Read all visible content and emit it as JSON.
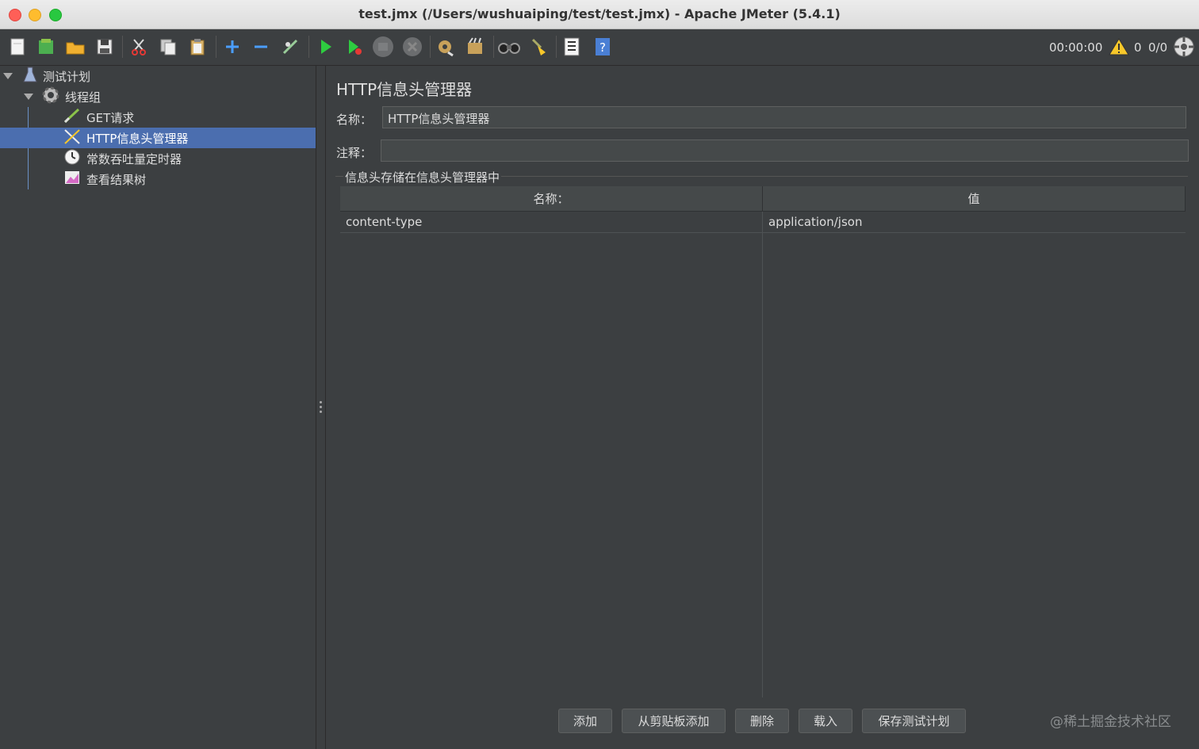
{
  "window": {
    "title": "test.jmx (/Users/wushuaiping/test/test.jmx) - Apache JMeter (5.4.1)"
  },
  "toolbar": {
    "icons": [
      "new-icon",
      "templates-icon",
      "open-icon",
      "save-icon",
      "cut-icon",
      "copy-icon",
      "paste-icon",
      "expand-icon",
      "collapse-icon",
      "toggle-icon",
      "start-icon",
      "start-no-pauses-icon",
      "stop-icon",
      "shutdown-icon",
      "clear-icon",
      "clear-all-icon",
      "search-icon",
      "reset-search-icon",
      "function-helper-icon",
      "help-icon"
    ],
    "timer": "00:00:00",
    "warning_count": "0",
    "threads": "0/0"
  },
  "tree": {
    "items": [
      {
        "label": "测试计划",
        "icon": "test-plan-icon"
      },
      {
        "label": "线程组",
        "icon": "thread-group-icon"
      },
      {
        "label": "GET请求",
        "icon": "sampler-icon"
      },
      {
        "label": "HTTP信息头管理器",
        "icon": "header-manager-icon",
        "selected": true
      },
      {
        "label": "常数吞吐量定时器",
        "icon": "timer-icon"
      },
      {
        "label": "查看结果树",
        "icon": "listener-icon"
      }
    ]
  },
  "panel": {
    "title": "HTTP信息头管理器",
    "name_label": "名称：",
    "name_value": "HTTP信息头管理器",
    "comment_label": "注释：",
    "comment_value": "",
    "group_title": "信息头存储在信息头管理器中",
    "table": {
      "headers": [
        "名称：",
        "值"
      ],
      "rows": [
        [
          "content-type",
          "application/json"
        ]
      ]
    },
    "buttons": {
      "add": "添加",
      "add_from_clipboard": "从剪贴板添加",
      "delete": "删除",
      "load": "载入",
      "save_test_plan": "保存测试计划"
    },
    "watermark": "@稀土掘金技术社区"
  }
}
